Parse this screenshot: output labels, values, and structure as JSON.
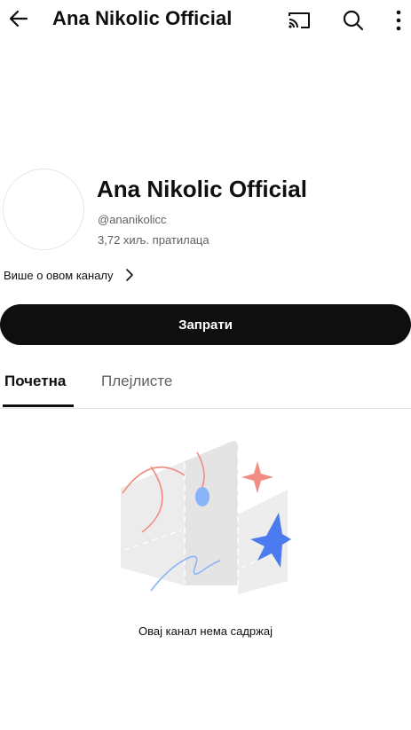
{
  "topbar": {
    "title": "Ana Nikolic Official",
    "icons": {
      "back": "arrow-left-icon",
      "cast": "cast-icon",
      "search": "search-icon",
      "more": "more-vertical-icon"
    }
  },
  "channel": {
    "name": "Ana Nikolic Official",
    "handle": "@ananikolicc",
    "subscribers": "3,72 хиљ. пратилаца",
    "more_about": "Више о овом каналу",
    "more_about_icon": "chevron-right-icon"
  },
  "subscribe": {
    "label": "Запрати"
  },
  "tabs": [
    {
      "label": "Почетна",
      "selected": true
    },
    {
      "label": "Плејлисте",
      "selected": false
    }
  ],
  "empty_state": {
    "illustration": "empty-channel-illustration",
    "message": "Овај канал нема садржај"
  },
  "colors": {
    "text_primary": "#0f0f0f",
    "text_secondary": "#606060",
    "button_bg": "#0f0f0f",
    "button_text": "#ffffff",
    "accent_red": "#f28b82",
    "accent_blue": "#4c7bf0"
  }
}
